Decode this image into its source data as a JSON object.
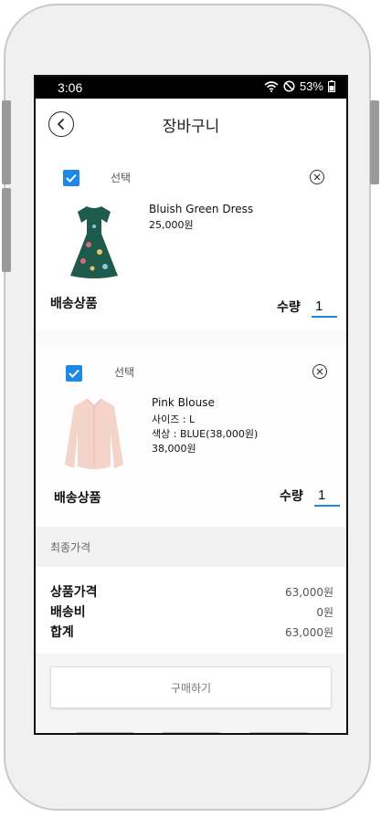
{
  "status_bar": {
    "time": "3:06",
    "battery": "53%"
  },
  "header": {
    "title": "장바구니"
  },
  "cart_items": [
    {
      "select_label": "선택",
      "name": "Bluish Green Dress",
      "details": [],
      "price": "25,000원",
      "shipping_label": "배송상품",
      "quantity_label": "수량",
      "quantity": "1",
      "image_icon": "dress-icon"
    },
    {
      "select_label": "선택",
      "name": "Pink Blouse",
      "details": [
        "사이즈 : L",
        "색상 : BLUE(38,000원)"
      ],
      "price": "38,000원",
      "shipping_label": "배송상품",
      "quantity_label": "수량",
      "quantity": "1",
      "image_icon": "blouse-icon"
    }
  ],
  "summary": {
    "section_title": "최종가격",
    "product_price_label": "상품가격",
    "product_price": "63,000원",
    "shipping_label": "배송비",
    "shipping_fee": "0원",
    "total_label": "합계",
    "total": "63,000원"
  },
  "buy_button": {
    "label": "구매하기"
  },
  "colors": {
    "accent": "#1e88e5",
    "status_bar": "#000000",
    "band": "#f2f2f2"
  }
}
